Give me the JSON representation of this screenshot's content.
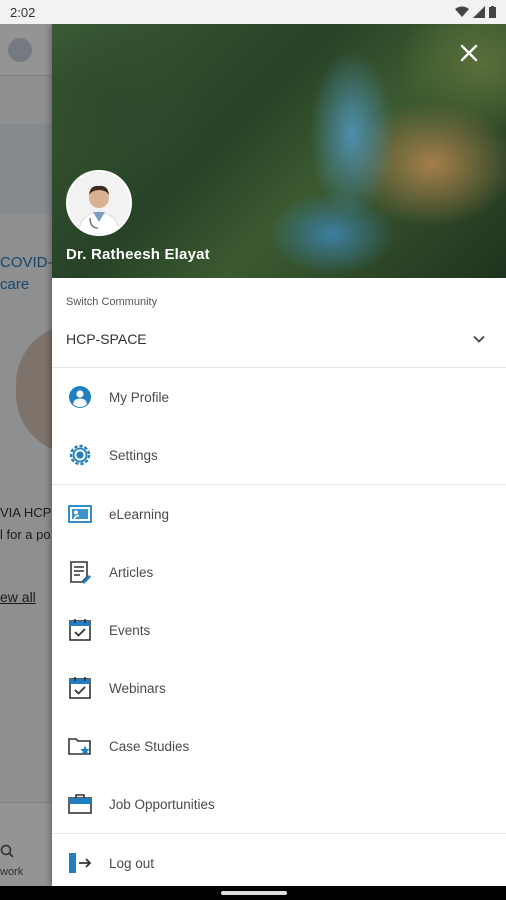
{
  "status_bar": {
    "time": "2:02"
  },
  "background": {
    "title_lines": [
      "COVID-",
      "care"
    ],
    "text_lines": [
      "VIA HCP S",
      "l for a po"
    ],
    "view_all": "ew all",
    "nav_label": "work"
  },
  "drawer": {
    "user_name": "Dr. Ratheesh Elayat",
    "community": {
      "label": "Switch Community",
      "value": "HCP-SPACE"
    },
    "menu_group1": [
      {
        "label": "My Profile",
        "icon": "person-icon"
      },
      {
        "label": "Settings",
        "icon": "gear-icon"
      }
    ],
    "menu_group2": [
      {
        "label": "eLearning",
        "icon": "presentation-icon"
      },
      {
        "label": "Articles",
        "icon": "article-icon"
      },
      {
        "label": "Events",
        "icon": "calendar-check-icon"
      },
      {
        "label": "Webinars",
        "icon": "calendar-check-icon"
      },
      {
        "label": "Case Studies",
        "icon": "folder-star-icon"
      },
      {
        "label": "Job Opportunities",
        "icon": "briefcase-icon"
      }
    ],
    "logout": {
      "label": "Log out",
      "icon": "logout-icon"
    }
  },
  "colors": {
    "accent": "#1f7fc2",
    "scrim": "#000000"
  }
}
